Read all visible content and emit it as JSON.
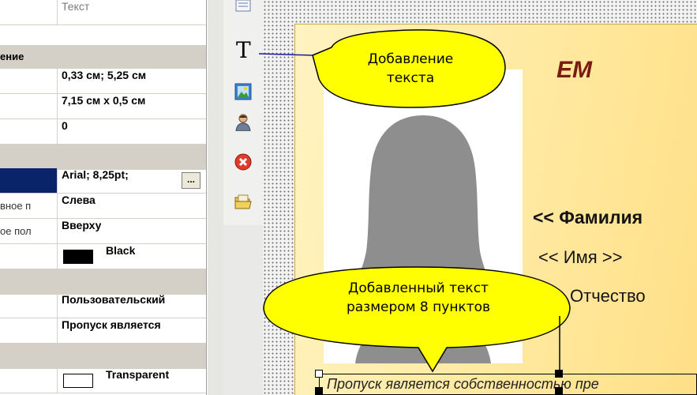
{
  "property_grid": {
    "header_name": "",
    "header_value": "Текст",
    "rows": [
      {
        "kind": "category",
        "name": "ение",
        "value": ""
      },
      {
        "kind": "prop",
        "name": "",
        "value": "0,33 см; 5,25 см"
      },
      {
        "kind": "prop",
        "name": "",
        "value": "7,15 см х 0,5 см"
      },
      {
        "kind": "prop",
        "name": "",
        "value": "0"
      },
      {
        "kind": "category",
        "name": "",
        "value": ""
      },
      {
        "kind": "font",
        "name": "",
        "value": "Arial; 8,25pt;",
        "button": "..."
      },
      {
        "kind": "prop",
        "name": "вное п",
        "value": "Слева"
      },
      {
        "kind": "prop",
        "name": "ое пол",
        "value": "Вверху"
      },
      {
        "kind": "color",
        "name": "",
        "value": "Black",
        "swatch": "#000000"
      },
      {
        "kind": "category",
        "name": "",
        "value": ""
      },
      {
        "kind": "prop",
        "name": "",
        "value": "Пользовательский"
      },
      {
        "kind": "prop",
        "name": "",
        "value": "Пропуск является"
      },
      {
        "kind": "category",
        "name": "",
        "value": ""
      },
      {
        "kind": "color",
        "name": "",
        "value": "Transparent",
        "swatch": "#ffffff"
      }
    ]
  },
  "toolbar": {
    "tools": [
      {
        "icon": "list-icon"
      },
      {
        "icon": "text-tool-icon",
        "glyph": "T"
      },
      {
        "icon": "picture-icon"
      },
      {
        "icon": "person-icon"
      },
      {
        "icon": "delete-icon"
      },
      {
        "icon": "folder-icon"
      }
    ]
  },
  "card": {
    "header_fragment": "EM",
    "surname_field": "<< Фамилия",
    "name_field": "<< Имя >>",
    "patronymic_field": "Отчество",
    "bottom_text": "Пропуск является собственностью пре"
  },
  "callouts": {
    "top": {
      "line1": "Добавление",
      "line2": "текста"
    },
    "bottom": {
      "line1": "Добавленный текст",
      "line2": "размером 8 пунктов"
    }
  },
  "colors": {
    "selection": "#0a246a",
    "callout_fill": "#ffff00",
    "card_gradient_start": "#fff3c0",
    "card_gradient_end": "#ffdf86"
  }
}
